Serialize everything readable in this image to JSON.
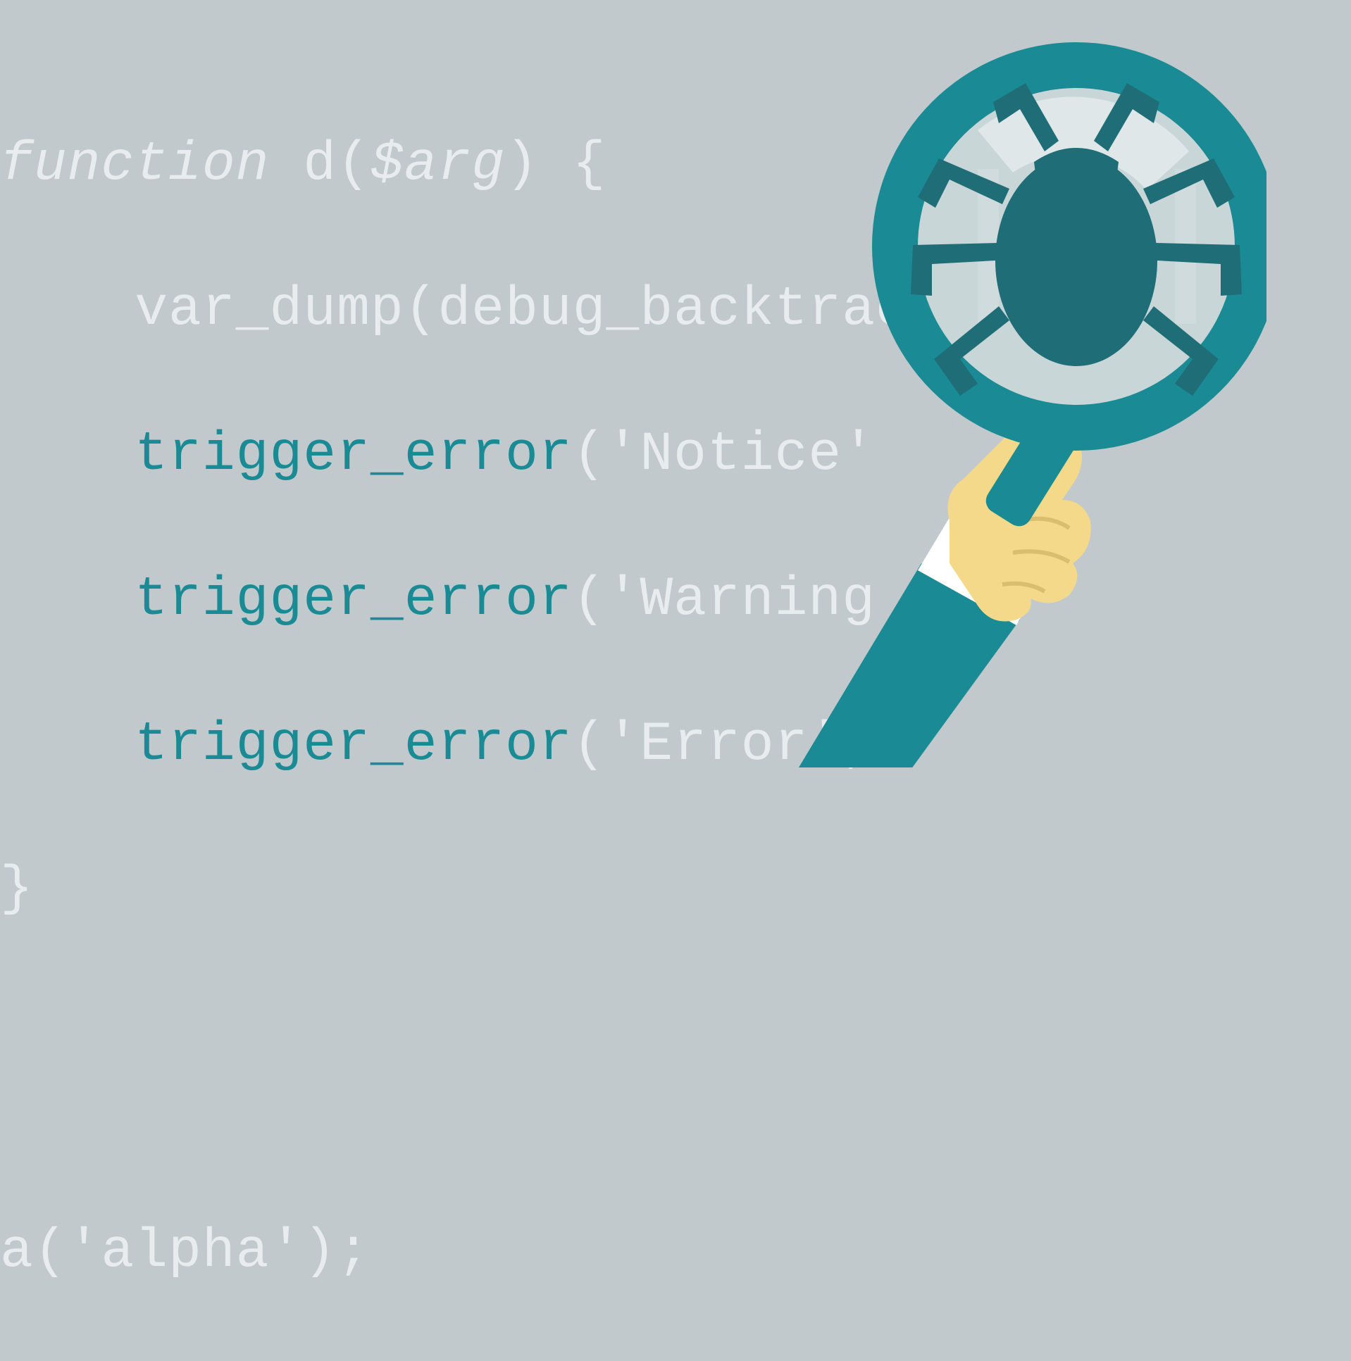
{
  "code": {
    "l1_kw": "function",
    "l1_fn": " d(",
    "l1_var": "$arg",
    "l1_end": ") {",
    "l2": "    var_dump(debug_backtrace());",
    "l3_a": "    ",
    "l3_b": "trigger_error",
    "l3_c": "('Notice'",
    "l4_a": "    ",
    "l4_b": "trigger_error",
    "l4_c": "('Warning",
    "l5_a": "    ",
    "l5_b": "trigger_error",
    "l5_c": "('Error',",
    "l6": "}",
    "l7": "",
    "l8": "a('alpha');"
  }
}
